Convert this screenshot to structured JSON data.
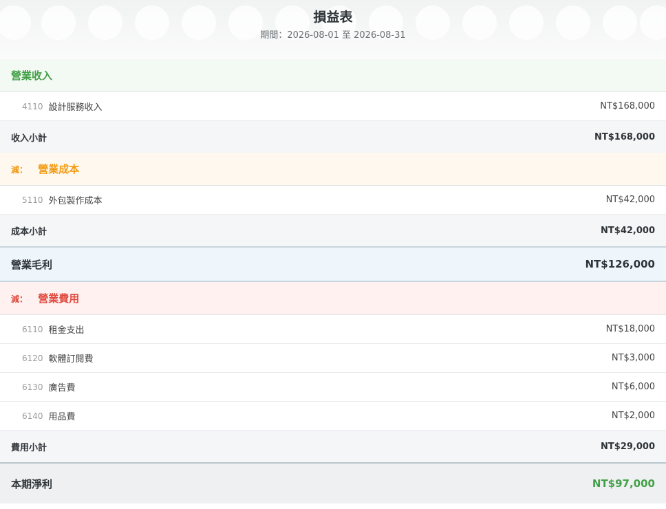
{
  "header": {
    "title": "損益表",
    "period": "期間：2026-08-01 至 2026-08-31"
  },
  "revenue": {
    "title": "營業收入",
    "items": [
      {
        "code": "4110",
        "name": "設計服務收入",
        "amount": "NT$168,000"
      }
    ],
    "subtotal_label": "收入小計",
    "subtotal": "NT$168,000"
  },
  "cost": {
    "less": "減：",
    "title": "營業成本",
    "items": [
      {
        "code": "5110",
        "name": "外包製作成本",
        "amount": "NT$42,000"
      }
    ],
    "subtotal_label": "成本小計",
    "subtotal": "NT$42,000"
  },
  "gross_profit": {
    "label": "營業毛利",
    "amount": "NT$126,000"
  },
  "expenses": {
    "less": "減：",
    "title": "營業費用",
    "items": [
      {
        "code": "6110",
        "name": "租金支出",
        "amount": "NT$18,000"
      },
      {
        "code": "6120",
        "name": "軟體訂閱費",
        "amount": "NT$3,000"
      },
      {
        "code": "6130",
        "name": "廣告費",
        "amount": "NT$6,000"
      },
      {
        "code": "6140",
        "name": "用品費",
        "amount": "NT$2,000"
      }
    ],
    "subtotal_label": "費用小計",
    "subtotal": "NT$29,000"
  },
  "net_income": {
    "label": "本期淨利",
    "amount": "NT$97,000"
  },
  "colors": {
    "revenue": "#43a047",
    "cost": "#f29b12",
    "expense": "#e04b3f",
    "net_income": "#43a047"
  }
}
